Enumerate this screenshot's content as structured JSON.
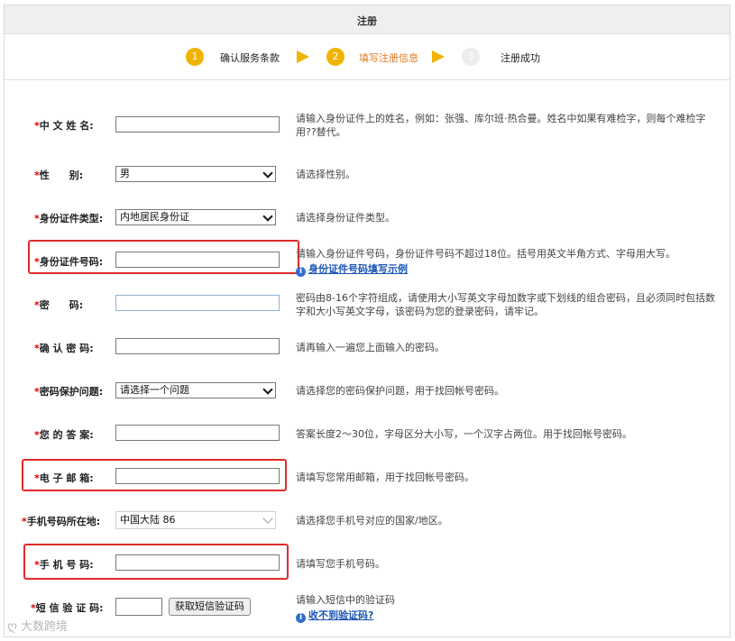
{
  "header": {
    "title": "注册"
  },
  "steps": [
    {
      "number": "1",
      "label": "确认服务条款",
      "state": "done"
    },
    {
      "number": "2",
      "label": "填写注册信息",
      "state": "current"
    },
    {
      "number": "3",
      "label": "注册成功",
      "state": "todo"
    }
  ],
  "colors": {
    "accent": "#f0b400",
    "current_step_text": "#e07b20",
    "required": "#d40000",
    "link": "#1a55b5",
    "highlight": "#e02a2a"
  },
  "form": {
    "chinese_name": {
      "label": "中 文 姓 名:",
      "value": "",
      "hint": "请输入身份证件上的姓名，例如：张强、库尔班·热合曼。姓名中如果有难检字，则每个难检字用??替代。"
    },
    "gender": {
      "label": "性　　别:",
      "value": "男",
      "hint": "请选择性别。"
    },
    "id_type": {
      "label": "身份证件类型:",
      "value": "内地居民身份证",
      "hint": "请选择身份证件类型。"
    },
    "id_number": {
      "label": "身份证件号码:",
      "value": "",
      "hint": "请输入身份证件号码，身份证件号码不超过18位。括号用英文半角方式、字母用大写。",
      "link": "身份证件号码填写示例"
    },
    "password": {
      "label": "密　　码:",
      "value": "",
      "hint": "密码由8-16个字符组成，请使用大小写英文字母加数字或下划线的组合密码，且必须同时包括数字和大小写英文字母，该密码为您的登录密码，请牢记。"
    },
    "confirm_password": {
      "label": "确 认 密 码:",
      "value": "",
      "hint": "请再输入一遍您上面输入的密码。"
    },
    "security_question": {
      "label": "密码保护问题:",
      "value": "请选择一个问题",
      "hint": "请选择您的密码保护问题，用于找回帐号密码。"
    },
    "answer": {
      "label": "您 的 答 案:",
      "value": "",
      "hint": "答案长度2～30位，字母区分大小写，一个汉字占两位。用于找回帐号密码。"
    },
    "email": {
      "label": "电 子 邮 箱:",
      "value": "",
      "hint": "请填写您常用邮箱，用于找回帐号密码。"
    },
    "phone_region": {
      "label": "手机号码所在地:",
      "value": "中国大陆 86",
      "hint": "请选择您手机号对应的国家/地区。"
    },
    "phone": {
      "label": "手 机 号 码:",
      "value": "",
      "hint": "请填写您手机号码。"
    },
    "sms_code": {
      "label": "短 信 验 证 码:",
      "value": "",
      "button": "获取短信验证码",
      "hint": "请输入短信中的验证码",
      "link": "收不到验证码?"
    }
  },
  "required_mark": "*",
  "info_icon": "i",
  "watermark": {
    "icon": "ღ",
    "text": "大数跨境"
  }
}
